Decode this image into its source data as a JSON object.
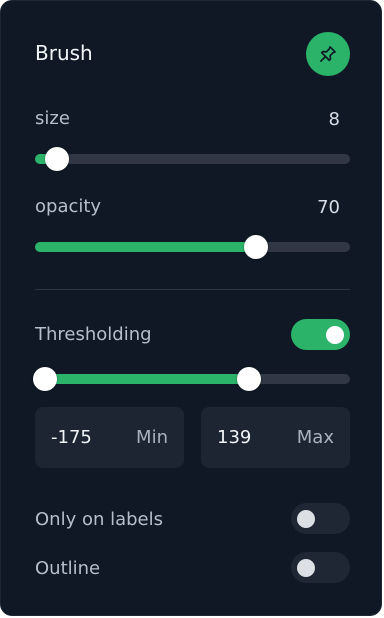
{
  "panel": {
    "title": "Brush",
    "pin_icon": "pin-icon",
    "accent_color": "#2bb36a"
  },
  "size": {
    "label": "size",
    "value": "8",
    "fraction": 0.07
  },
  "opacity": {
    "label": "opacity",
    "value": "70",
    "fraction": 0.7
  },
  "thresholding": {
    "label": "Thresholding",
    "enabled": true,
    "range_low_fraction": 0.0,
    "range_high_fraction": 0.68,
    "min": {
      "value": "-175",
      "unit": "Min"
    },
    "max": {
      "value": "139",
      "unit": "Max"
    }
  },
  "only_on_labels": {
    "label": "Only on labels",
    "enabled": false
  },
  "outline": {
    "label": "Outline",
    "enabled": false
  }
}
